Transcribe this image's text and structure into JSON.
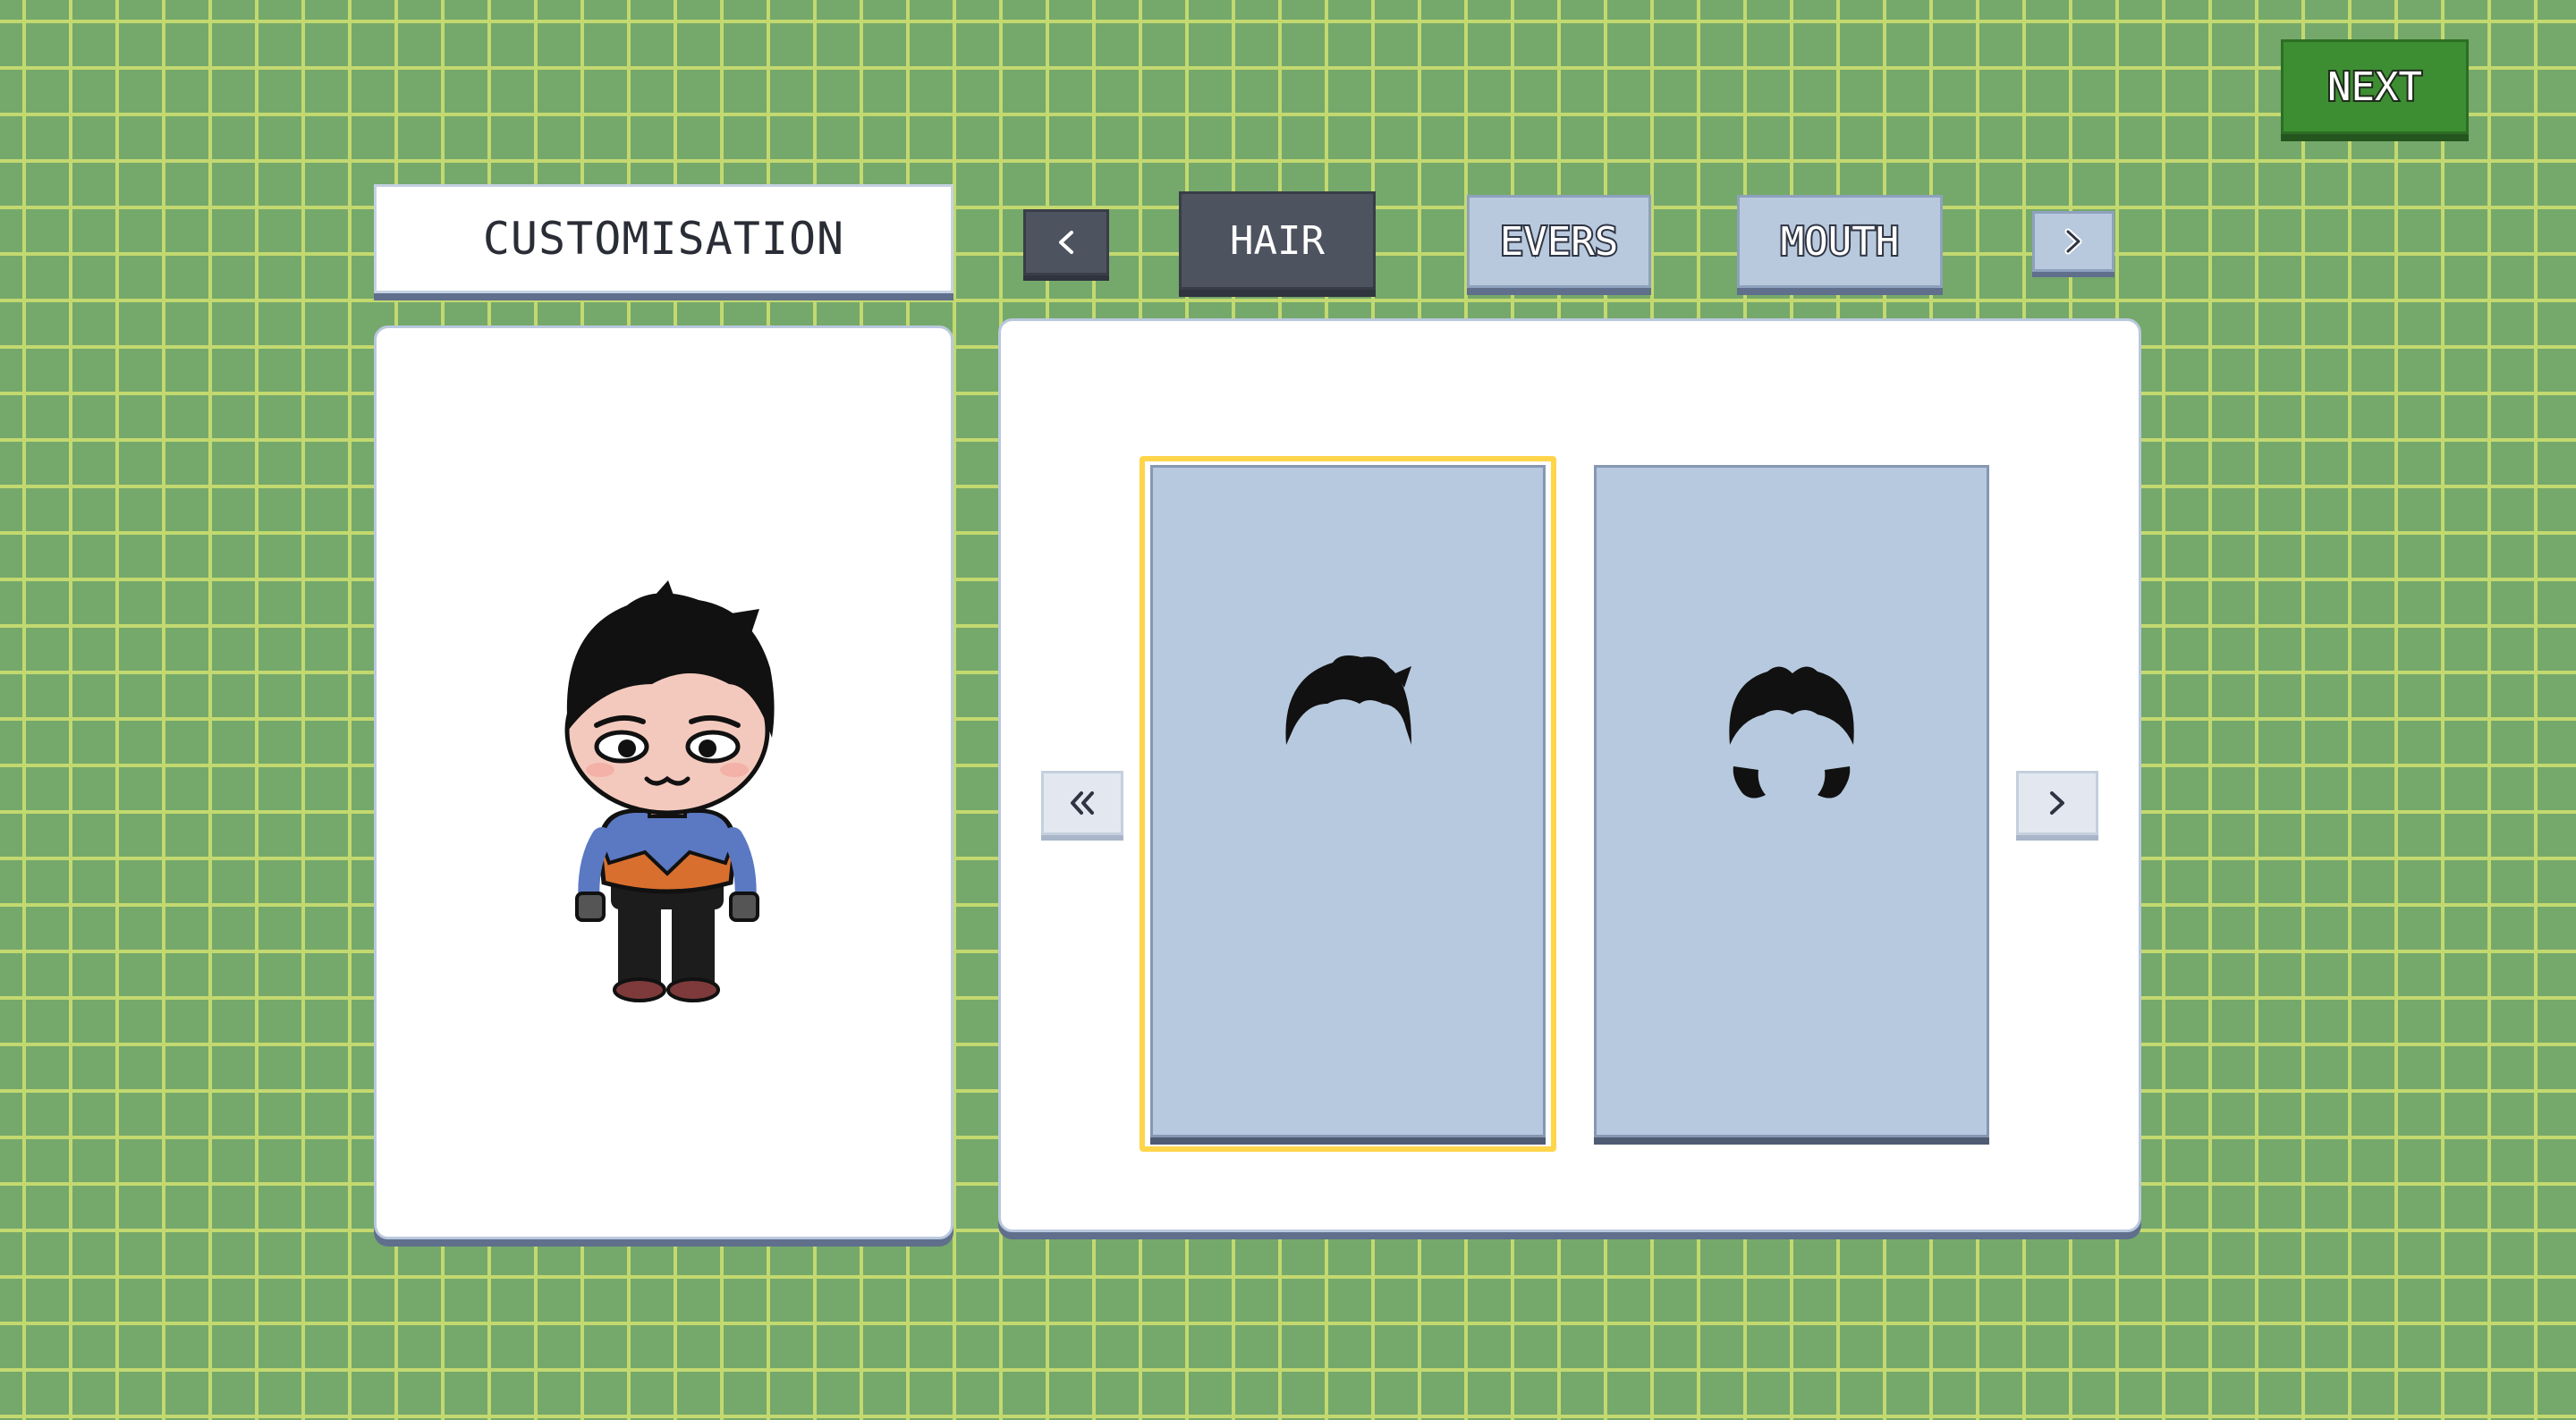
{
  "header": {
    "title": "CUSTOMISATION",
    "next_label": "NEXT"
  },
  "tabs": [
    {
      "label": "HAIR",
      "active": true
    },
    {
      "label": "EVERS",
      "active": false
    },
    {
      "label": "MOUTH",
      "active": false
    }
  ],
  "tab_nav": {
    "prev_icon": "chevron-left-icon",
    "next_icon": "chevron-right-icon"
  },
  "options": {
    "items": [
      {
        "icon": "short-hair-icon",
        "selected": true
      },
      {
        "icon": "spiky-hair-icon",
        "selected": false
      }
    ],
    "prev_icon": "double-chevron-left-icon",
    "next_icon": "chevron-right-icon"
  },
  "colors": {
    "background": "#75a86b",
    "grid_line": "#c3d970",
    "active_tab": "#4d535f",
    "inactive_tab": "#b8c9de",
    "card": "#b7c9df",
    "selection": "#ffd54a",
    "next_button": "#3d8e32"
  }
}
